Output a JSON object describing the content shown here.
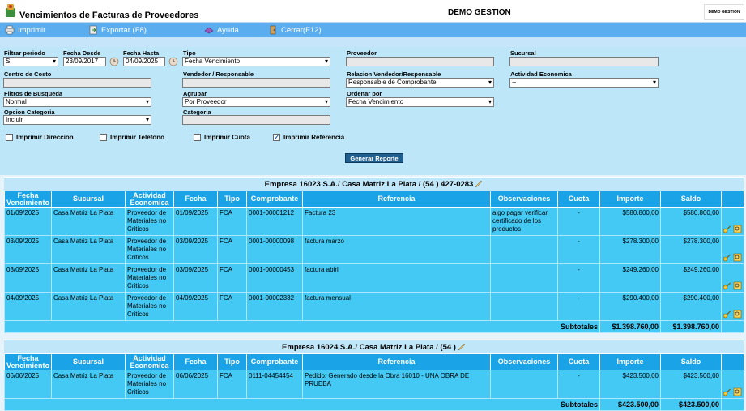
{
  "app": {
    "title": "Vencimientos de Facturas de Proveedores",
    "company": "DEMO GESTION",
    "brand_text": "DEMO GESTION",
    "logo_icon": "app-logo-icon"
  },
  "toolbar": [
    {
      "label": "Imprimir",
      "icon": "printer-icon"
    },
    {
      "label": "Exportar (F8)",
      "icon": "export-icon"
    },
    {
      "label": "Ayuda",
      "icon": "help-icon"
    },
    {
      "label": "Cerrar(F12)",
      "icon": "close-icon"
    }
  ],
  "filters": {
    "filtrar_periodo": {
      "label": "Filtrar periodo",
      "value": "SI"
    },
    "fecha_desde": {
      "label": "Fecha Desde",
      "value": "23/09/2017"
    },
    "fecha_hasta": {
      "label": "Fecha Hasta",
      "value": "04/09/2025"
    },
    "tipo": {
      "label": "Tipo",
      "value": "Fecha Vencimiento"
    },
    "proveedor": {
      "label": "Proveedor",
      "value": ""
    },
    "sucursal": {
      "label": "Sucursal",
      "value": ""
    },
    "centro_costo": {
      "label": "Centro de Costo",
      "value": ""
    },
    "vendedor": {
      "label": "Vendedor / Responsable",
      "value": ""
    },
    "relacion": {
      "label": "Relacion Vendedor/Responsable",
      "value": "Responsable de Comprobante"
    },
    "actividad": {
      "label": "Actividad Economica",
      "value": "--"
    },
    "filtros_busqueda": {
      "label": "Filtros de Busqueda",
      "value": "Normal"
    },
    "agrupar": {
      "label": "Agrupar",
      "value": "Por Proveedor"
    },
    "ordenar": {
      "label": "Ordenar por",
      "value": "Fecha Vencimiento"
    },
    "opcion_categoria": {
      "label": "Opcion Categoria",
      "value": "Incluir"
    },
    "categoria": {
      "label": "Categoria",
      "value": ""
    }
  },
  "checkboxes": [
    {
      "label": "Imprimir Direccion",
      "checked": false
    },
    {
      "label": "Imprimir Telefono",
      "checked": false
    },
    {
      "label": "Imprimir Cuota",
      "checked": false
    },
    {
      "label": "Imprimir Referencia",
      "checked": true
    }
  ],
  "generate_label": "Generar Reporte",
  "columns": [
    "Fecha Vencimiento",
    "Sucursal",
    "Actividad Economica",
    "Fecha",
    "Tipo",
    "Comprobante",
    "Referencia",
    "Observaciones",
    "Cuota",
    "Importe",
    "Saldo",
    ""
  ],
  "groups": [
    {
      "title": "Empresa 16023 S.A./ Casa Matriz La Plata / (54 ) 427-0283",
      "rows": [
        {
          "venc": "01/09/2025",
          "sucursal": "Casa Matriz La Plata",
          "actividad": "Proveedor de Materiales no Criticos",
          "fecha": "01/09/2025",
          "tipo": "FCA",
          "comprobante": "0001-00001212",
          "referencia": "Factura 23",
          "observaciones": "algo pagar verificar certificado de los productos",
          "cuota": "-",
          "importe": "$580.800,00",
          "saldo": "$580.800,00"
        },
        {
          "venc": "03/09/2025",
          "sucursal": "Casa Matriz La Plata",
          "actividad": "Proveedor de Materiales no Criticos",
          "fecha": "03/09/2025",
          "tipo": "FCA",
          "comprobante": "0001-00000098",
          "referencia": "factura marzo",
          "observaciones": "",
          "cuota": "-",
          "importe": "$278.300,00",
          "saldo": "$278.300,00"
        },
        {
          "venc": "03/09/2025",
          "sucursal": "Casa Matriz La Plata",
          "actividad": "Proveedor de Materiales no Criticos",
          "fecha": "03/09/2025",
          "tipo": "FCA",
          "comprobante": "0001-00000453",
          "referencia": "factura abirl",
          "observaciones": "",
          "cuota": "-",
          "importe": "$249.260,00",
          "saldo": "$249.260,00"
        },
        {
          "venc": "04/09/2025",
          "sucursal": "Casa Matriz La Plata",
          "actividad": "Proveedor de Materiales no Criticos",
          "fecha": "04/09/2025",
          "tipo": "FCA",
          "comprobante": "0001-00002332",
          "referencia": "factura mensual",
          "observaciones": "",
          "cuota": "-",
          "importe": "$290.400,00",
          "saldo": "$290.400,00"
        }
      ],
      "subtotal_label": "Subtotales",
      "subtotal_importe": "$1.398.760,00",
      "subtotal_saldo": "$1.398.760,00"
    },
    {
      "title": "Empresa 16024 S.A./ Casa Matriz La Plata / (54 )",
      "rows": [
        {
          "venc": "06/06/2025",
          "sucursal": "Casa Matriz La Plata",
          "actividad": "Proveedor de Materiales no Criticos",
          "fecha": "06/06/2025",
          "tipo": "FCA",
          "comprobante": "0111-04454454",
          "referencia": "Pedido: Generado desde la Obra 16010 - UNA OBRA DE PRUEBA",
          "observaciones": "",
          "cuota": "-",
          "importe": "$423.500,00",
          "saldo": "$423.500,00"
        }
      ],
      "subtotal_label": "Subtotales",
      "subtotal_importe": "$423.500,00",
      "subtotal_saldo": "$423.500,00"
    }
  ]
}
